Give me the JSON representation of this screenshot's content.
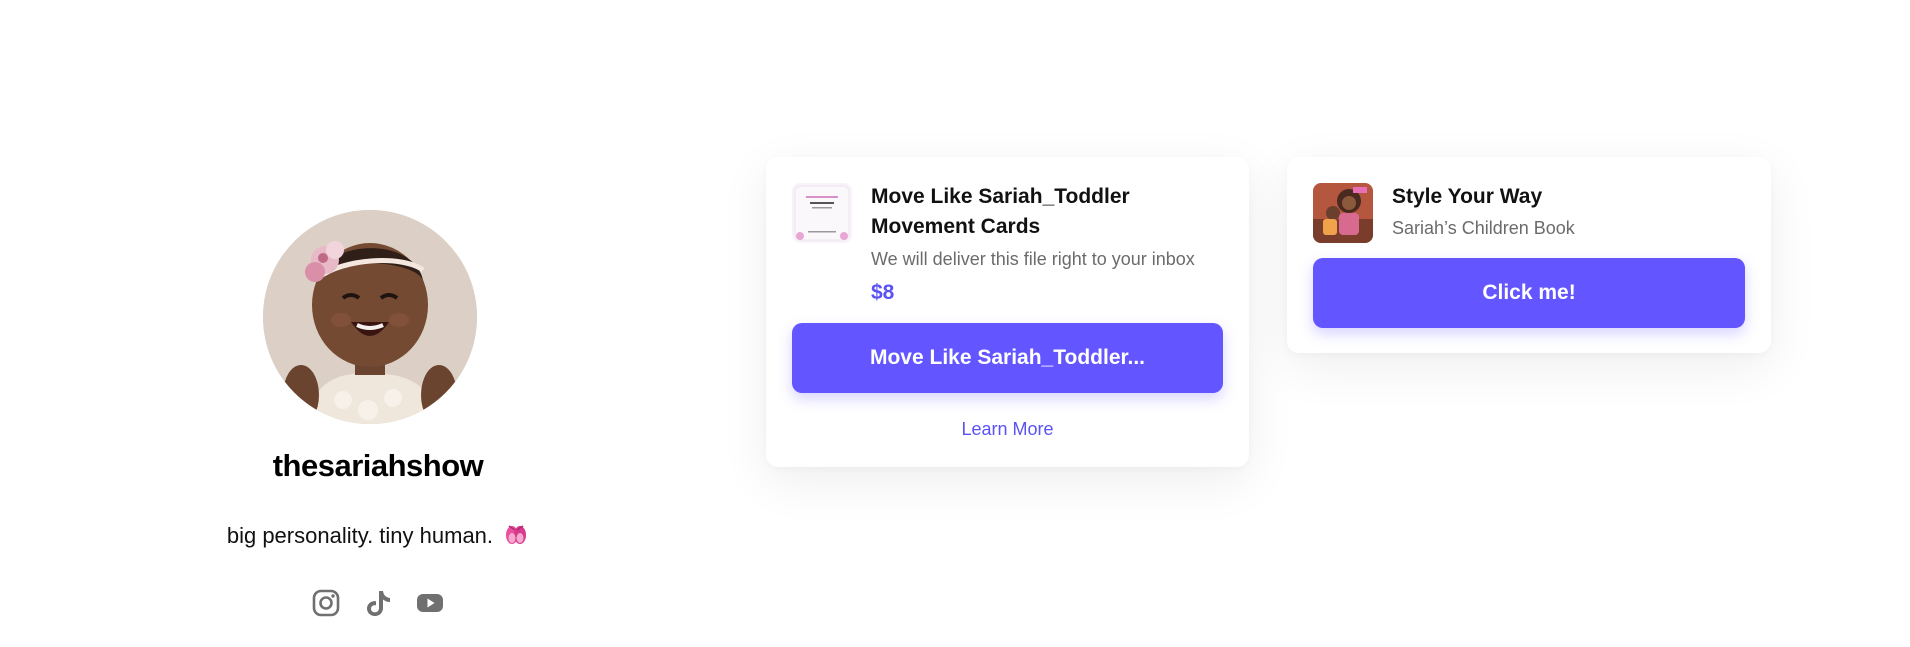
{
  "profile": {
    "username": "thesariahshow",
    "bio": "big personality. tiny human.",
    "bio_emoji": "ballet-shoes-icon",
    "socials": [
      {
        "name": "instagram-icon"
      },
      {
        "name": "tiktok-icon"
      },
      {
        "name": "youtube-icon"
      }
    ]
  },
  "cards": {
    "product": {
      "title": "Move Like Sariah_Toddler Movement Cards",
      "subtitle": "We will deliver this file right to your inbox",
      "price": "$8",
      "button": "Move Like Sariah_Toddler...",
      "learn_more": "Learn More",
      "thumb_text": "MOVE LIKE SARIAH"
    },
    "book": {
      "title": "Style Your Way",
      "subtitle": "Sariah’s Children Book",
      "button": "Click me!"
    }
  },
  "colors": {
    "accent": "#6355ff",
    "accent_text": "#5b52f5",
    "muted_text": "#6b6b6b",
    "icon_gray": "#707070"
  }
}
